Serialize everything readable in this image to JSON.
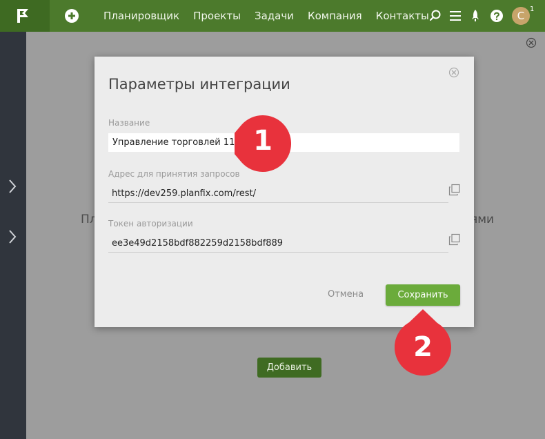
{
  "header": {
    "nav_items": [
      "Планировщик",
      "Проекты",
      "Задачи",
      "Компания",
      "Контакты"
    ],
    "avatar_letter": "С",
    "notification_count": "1",
    "brand_color": "#4c7a2c"
  },
  "background": {
    "partial_text_left": "Пл",
    "partial_text_right": "ями",
    "add_button": "Добавить"
  },
  "modal": {
    "title": "Параметры интеграции",
    "name_label": "Название",
    "name_value": "Управление торговлей 11",
    "url_label": "Адрес для принятия запросов",
    "url_value": "https://dev259.planfix.com/rest/",
    "token_label": "Токен авторизации",
    "token_value": "ee3e49d2158bdf882259d2158bdf889",
    "cancel": "Отмена",
    "save": "Сохранить"
  },
  "annotations": {
    "marker_1": "1",
    "marker_2": "2",
    "marker_color": "#e8323c"
  }
}
